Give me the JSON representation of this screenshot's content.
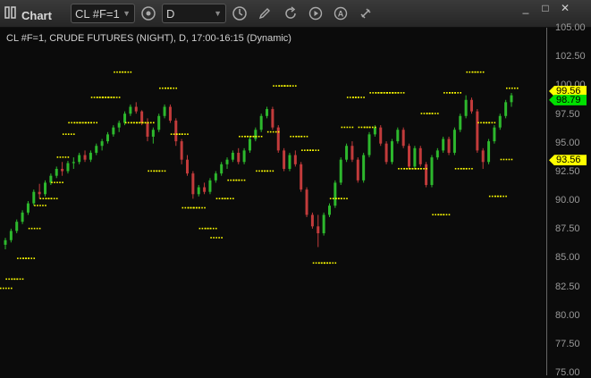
{
  "window": {
    "title": "Chart"
  },
  "toolbar": {
    "symbol_value": "CL #F=1",
    "interval_value": "D",
    "icons": [
      "panels-icon",
      "cycle-icon",
      "clock-icon",
      "pencil-icon",
      "refresh-icon",
      "play-icon",
      "alert-icon",
      "link-icon",
      "settings-icon"
    ]
  },
  "window_controls": {
    "minimize": "_",
    "restore": "□",
    "close": "✕"
  },
  "chart_header": "CL #F=1, CRUDE FUTURES (NIGHT), D, 17:00-16:15 (Dynamic)",
  "price_axis": {
    "labels": [
      "105.00",
      "102.50",
      "100.00",
      "97.50",
      "95.00",
      "92.50",
      "90.00",
      "87.50",
      "85.00",
      "82.50",
      "80.00",
      "77.50",
      "75.00"
    ]
  },
  "price_tags": [
    {
      "value": "99.56",
      "color": "#ffff00"
    },
    {
      "value": "98.79",
      "color": "#00e000"
    },
    {
      "value": "93.56",
      "color": "#ffff00"
    }
  ],
  "colors": {
    "up": "#2db82d",
    "down": "#c23b3b",
    "dots": "#ffff00",
    "background": "#0b0b0b"
  },
  "chart_data": {
    "type": "candlestick",
    "ylim": [
      75,
      105
    ],
    "candles": [
      [
        86.2,
        86.8,
        85.8,
        86.6
      ],
      [
        86.6,
        87.6,
        86.4,
        87.4
      ],
      [
        87.4,
        88.4,
        87.2,
        88.2
      ],
      [
        88.2,
        89.2,
        88,
        89
      ],
      [
        89,
        90,
        88.8,
        89.8
      ],
      [
        89.8,
        91,
        89.6,
        90.8
      ],
      [
        90.8,
        91.5,
        90.2,
        90.6
      ],
      [
        90.6,
        91.8,
        90.4,
        91.6
      ],
      [
        91.6,
        92.4,
        91.4,
        92.2
      ],
      [
        92.2,
        93,
        92,
        92.8
      ],
      [
        92.8,
        93.4,
        92.2,
        92.6
      ],
      [
        92.6,
        93.5,
        92.4,
        93.3
      ],
      [
        93.3,
        93.8,
        92.8,
        93.4
      ],
      [
        93.4,
        94.2,
        93.2,
        94
      ],
      [
        94,
        94.4,
        93.4,
        93.6
      ],
      [
        93.6,
        94.4,
        93.4,
        94.2
      ],
      [
        94.2,
        95,
        94,
        94.8
      ],
      [
        94.8,
        95.4,
        94.4,
        95.2
      ],
      [
        95.2,
        96,
        95,
        95.8
      ],
      [
        95.8,
        96.6,
        95.6,
        96.4
      ],
      [
        96.4,
        97,
        96,
        96.8
      ],
      [
        96.8,
        97.8,
        96.6,
        97.6
      ],
      [
        97.6,
        98.4,
        97.4,
        98.2
      ],
      [
        98.2,
        98.6,
        97.6,
        97.8
      ],
      [
        97.8,
        97.9,
        96.6,
        96.8
      ],
      [
        96.8,
        97.2,
        95.2,
        95.6
      ],
      [
        95.6,
        96.4,
        95,
        96.2
      ],
      [
        96.2,
        97.6,
        96,
        97.4
      ],
      [
        97.4,
        98.4,
        97.2,
        98.2
      ],
      [
        98.2,
        98.4,
        96.8,
        97
      ],
      [
        97,
        97.2,
        94.8,
        95.2
      ],
      [
        95.2,
        95.4,
        93.2,
        93.6
      ],
      [
        93.6,
        94,
        92.2,
        92.4
      ],
      [
        92.4,
        92.6,
        90.2,
        90.6
      ],
      [
        90.6,
        91.4,
        90.4,
        91.2
      ],
      [
        91.2,
        91.6,
        90.6,
        90.8
      ],
      [
        90.8,
        92,
        90.6,
        91.8
      ],
      [
        91.8,
        92.6,
        91.6,
        92.4
      ],
      [
        92.4,
        93.4,
        92.2,
        93.2
      ],
      [
        93.2,
        93.8,
        92.8,
        93.6
      ],
      [
        93.6,
        94.4,
        93.4,
        94.2
      ],
      [
        94.2,
        94.6,
        93.2,
        93.4
      ],
      [
        93.4,
        94.6,
        93.2,
        94.4
      ],
      [
        94.4,
        95.6,
        94.2,
        95.4
      ],
      [
        95.4,
        96.4,
        95.2,
        96.2
      ],
      [
        96.2,
        97.6,
        96,
        97.4
      ],
      [
        97.4,
        98.2,
        97.2,
        98
      ],
      [
        98,
        98.2,
        96.2,
        96.4
      ],
      [
        96.4,
        96.6,
        94.2,
        94.4
      ],
      [
        94.4,
        94.6,
        92.6,
        92.8
      ],
      [
        92.8,
        94.2,
        92.6,
        94
      ],
      [
        94,
        94.4,
        93,
        93.2
      ],
      [
        93.2,
        93.4,
        90.8,
        91
      ],
      [
        91,
        91.2,
        88.6,
        88.8
      ],
      [
        88.8,
        89,
        87.6,
        87.8
      ],
      [
        87.8,
        88.8,
        86,
        87.2
      ],
      [
        87.2,
        89,
        87,
        88.8
      ],
      [
        88.8,
        89.8,
        88.6,
        89.6
      ],
      [
        89.6,
        91.8,
        89.4,
        91.6
      ],
      [
        91.6,
        93.8,
        91.4,
        93.6
      ],
      [
        93.6,
        95,
        93.4,
        94.8
      ],
      [
        94.8,
        95.2,
        93.4,
        93.6
      ],
      [
        93.6,
        93.8,
        91.6,
        91.8
      ],
      [
        91.8,
        94.2,
        91.6,
        94
      ],
      [
        94,
        96,
        93.8,
        95.8
      ],
      [
        95.8,
        96.6,
        95.6,
        96.4
      ],
      [
        96.4,
        96.6,
        94.8,
        95
      ],
      [
        95,
        95.2,
        93.2,
        93.4
      ],
      [
        93.4,
        95.4,
        93.2,
        95.2
      ],
      [
        95.2,
        96.4,
        95,
        96.2
      ],
      [
        96.2,
        96.4,
        94.6,
        94.8
      ],
      [
        94.8,
        95,
        92.8,
        93
      ],
      [
        93,
        94.8,
        92.8,
        94.6
      ],
      [
        94.6,
        94.8,
        93,
        93.2
      ],
      [
        93.2,
        93.4,
        91.2,
        91.4
      ],
      [
        91.4,
        94,
        91.2,
        93.8
      ],
      [
        93.8,
        94.6,
        93.6,
        94.4
      ],
      [
        94.4,
        95.6,
        94.2,
        95.4
      ],
      [
        95.4,
        95.6,
        94,
        94.2
      ],
      [
        94.2,
        96.4,
        94,
        96.2
      ],
      [
        96.2,
        97.6,
        96,
        97.4
      ],
      [
        97.4,
        99.2,
        97.2,
        98.8
      ],
      [
        98.8,
        99,
        97.6,
        97.8
      ],
      [
        97.8,
        98,
        94.2,
        94.4
      ],
      [
        94.4,
        94.6,
        92.8,
        93.4
      ],
      [
        93.4,
        95.4,
        93.2,
        95.2
      ],
      [
        95.2,
        96.6,
        95,
        96.4
      ],
      [
        96.4,
        97.6,
        96.2,
        97.4
      ],
      [
        97.4,
        98.8,
        97.2,
        98.6
      ],
      [
        98.6,
        99.4,
        98.2,
        99.2
      ]
    ],
    "resistance_dots": [
      [
        1,
        82.4
      ],
      [
        2,
        83.2
      ],
      [
        3,
        83.2
      ],
      [
        4,
        85
      ],
      [
        5,
        85
      ],
      [
        6,
        87.6
      ],
      [
        7,
        89.6
      ],
      [
        8,
        90.2
      ],
      [
        9,
        90.2
      ],
      [
        10,
        91.6
      ],
      [
        11,
        93.8
      ],
      [
        12,
        95.8
      ],
      [
        13,
        96.8
      ],
      [
        14,
        96.8
      ],
      [
        15,
        96.8
      ],
      [
        16,
        96.8
      ],
      [
        17,
        99
      ],
      [
        18,
        99
      ],
      [
        19,
        99
      ],
      [
        20,
        99
      ],
      [
        21,
        101.2
      ],
      [
        22,
        101.2
      ],
      [
        23,
        96.8
      ],
      [
        24,
        96.8
      ],
      [
        25,
        96.8
      ],
      [
        26,
        96.8
      ],
      [
        27,
        92.6
      ],
      [
        28,
        92.6
      ],
      [
        29,
        99.8
      ],
      [
        30,
        99.8
      ],
      [
        31,
        95.8
      ],
      [
        32,
        95.8
      ],
      [
        33,
        89.4
      ],
      [
        34,
        89.4
      ],
      [
        35,
        89.4
      ],
      [
        36,
        87.6
      ],
      [
        37,
        87.6
      ],
      [
        38,
        86.8
      ],
      [
        39,
        90.2
      ],
      [
        40,
        90.2
      ],
      [
        41,
        91.8
      ],
      [
        42,
        91.8
      ],
      [
        43,
        95.6
      ],
      [
        44,
        95.6
      ],
      [
        45,
        95.6
      ],
      [
        46,
        92.6
      ],
      [
        47,
        92.6
      ],
      [
        48,
        96
      ],
      [
        49,
        100
      ],
      [
        50,
        100
      ],
      [
        51,
        100
      ],
      [
        52,
        95.6
      ],
      [
        53,
        95.6
      ],
      [
        54,
        94.4
      ],
      [
        55,
        94.4
      ],
      [
        56,
        84.6
      ],
      [
        57,
        84.6
      ],
      [
        58,
        84.6
      ],
      [
        59,
        90.2
      ],
      [
        60,
        90.2
      ],
      [
        61,
        96.4
      ],
      [
        62,
        99
      ],
      [
        63,
        99
      ],
      [
        64,
        96.4
      ],
      [
        65,
        96.4
      ],
      [
        66,
        99.4
      ],
      [
        67,
        99.4
      ],
      [
        68,
        99.4
      ],
      [
        69,
        99.4
      ],
      [
        70,
        99.4
      ],
      [
        71,
        92.8
      ],
      [
        72,
        92.8
      ],
      [
        73,
        92.8
      ],
      [
        74,
        92.8
      ],
      [
        75,
        97.6
      ],
      [
        76,
        97.6
      ],
      [
        77,
        88.8
      ],
      [
        78,
        88.8
      ],
      [
        79,
        99.4
      ],
      [
        80,
        99.4
      ],
      [
        81,
        92.8
      ],
      [
        82,
        92.8
      ],
      [
        83,
        101.2
      ],
      [
        84,
        101.2
      ],
      [
        85,
        96.8
      ],
      [
        86,
        96.8
      ],
      [
        87,
        90.4
      ],
      [
        88,
        90.4
      ],
      [
        89,
        93.6
      ],
      [
        90,
        99.8
      ]
    ]
  }
}
